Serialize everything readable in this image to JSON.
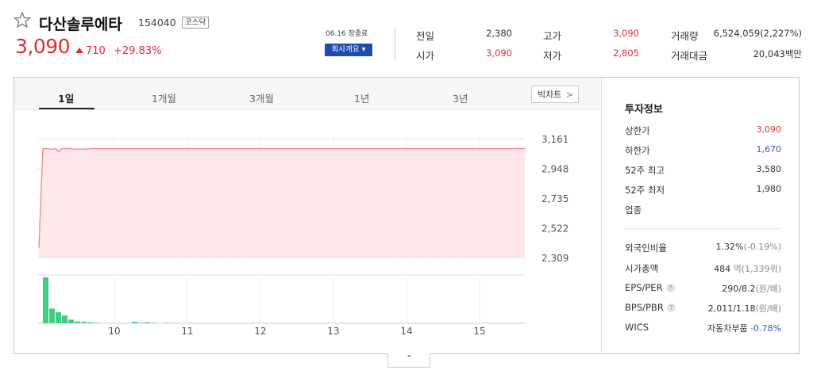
{
  "header": {
    "stock_name": "다산솔루에타",
    "stock_code": "154040",
    "market_badge": "코스닥",
    "price": "3,090",
    "change": "710",
    "change_pct": "+29.83%",
    "date_info": "06.16 장종료",
    "company_info_button": "회사개요 ▾"
  },
  "quotes": [
    {
      "label": "전일",
      "value": "2,380",
      "color": "#333333"
    },
    {
      "label": "시가",
      "value": "3,090",
      "color": "#e52d2d"
    },
    {
      "label": "고가",
      "value": "3,090",
      "color": "#e52d2d"
    },
    {
      "label": "저가",
      "value": "2,805",
      "color": "#e52d2d"
    },
    {
      "label": "거래량",
      "value": "6,524,059(2,227%)",
      "color": "#333333"
    },
    {
      "label": "거래대금",
      "value": "20,043백만",
      "color": "#333333"
    }
  ],
  "tabs": [
    "1일",
    "1개월",
    "3개월",
    "1년",
    "3년"
  ],
  "big_chart_button": "빅차트",
  "investment": {
    "title": "투자정보",
    "rows": [
      {
        "label": "상한가",
        "value": "3,090",
        "color": "#e52d2d"
      },
      {
        "label": "하한가",
        "value": "1,670",
        "color": "#2f5bd1"
      },
      {
        "label": "52주 최고",
        "value": "3,580",
        "color": "#333333"
      },
      {
        "label": "52주 최저",
        "value": "1,980",
        "color": "#333333"
      },
      {
        "label": "업종",
        "value": "",
        "color": "#333333"
      }
    ],
    "rows2": [
      {
        "label": "외국인비율",
        "value": "1.32%",
        "sub": "(-0.19%)",
        "help": false
      },
      {
        "label": "시가총액",
        "value": "484",
        "sub": "억(1,339위)",
        "help": false
      },
      {
        "label": "EPS/PER",
        "value": "290/8.2",
        "sub": "(원/배)",
        "help": true
      },
      {
        "label": "BPS/PBR",
        "value": "2,011/1.18",
        "sub": "(원/배)",
        "help": true
      }
    ],
    "wics_label": "WICS",
    "wics_value": "자동차부품",
    "wics_change": "-0.78%"
  },
  "chart_data": {
    "type": "line",
    "y_ticks": [
      "3,161",
      "2,948",
      "2,735",
      "2,522",
      "2,309"
    ],
    "ylim": [
      2309,
      3161
    ],
    "x_ticks": [
      "10",
      "11",
      "12",
      "13",
      "14",
      "15"
    ],
    "price_series": [
      2380,
      3090,
      3090,
      3085,
      3090,
      3068,
      3090,
      3090,
      3085,
      3090,
      3090,
      3090,
      3090,
      3090,
      3090,
      3090
    ],
    "volume_bars": [
      100,
      32,
      24,
      17,
      8,
      4,
      3,
      2,
      1,
      0,
      0,
      0,
      0,
      0,
      3,
      1,
      2,
      1,
      0,
      1
    ],
    "line_color": "#f0868c",
    "fill_color": "#fde7e8",
    "volume_color": "#3dd17f"
  }
}
